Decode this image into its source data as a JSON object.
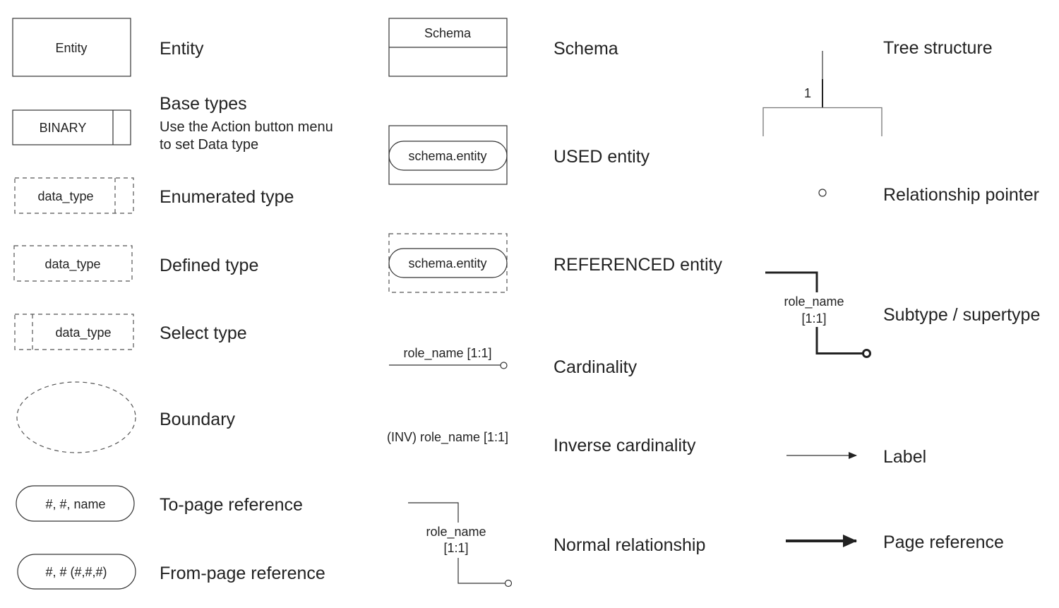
{
  "column1": {
    "entity": {
      "shape_text": "Entity",
      "label": "Entity"
    },
    "base_types": {
      "shape_text": "BINARY",
      "label": "Base types",
      "note_line1": "Use the Action button menu",
      "note_line2": "to set Data type"
    },
    "enumerated_type": {
      "shape_text": "data_type",
      "label": "Enumerated type"
    },
    "defined_type": {
      "shape_text": "data_type",
      "label": "Defined type"
    },
    "select_type": {
      "shape_text": "data_type",
      "label": "Select type"
    },
    "boundary": {
      "label": "Boundary"
    },
    "to_page_reference": {
      "shape_text": "#, #, name",
      "label": "To-page reference"
    },
    "from_page_reference": {
      "shape_text": "#, # (#,#,#)",
      "label": "From-page reference"
    }
  },
  "column2": {
    "schema": {
      "shape_text": "Schema",
      "label": "Schema"
    },
    "used_entity": {
      "shape_text": "schema.entity",
      "label": "USED entity"
    },
    "referenced_entity": {
      "shape_text": "schema.entity",
      "label": "REFERENCED entity"
    },
    "cardinality": {
      "shape_text": "role_name [1:1]",
      "label": "Cardinality"
    },
    "inverse_cardinality": {
      "shape_text": "(INV) role_name [1:1]",
      "label": "Inverse cardinality"
    },
    "normal_relationship": {
      "role": "role_name",
      "card": "[1:1]",
      "label": "Normal relationship"
    }
  },
  "column3": {
    "tree_structure": {
      "number": "1",
      "label": "Tree structure"
    },
    "relationship_pointer": {
      "label": "Relationship pointer"
    },
    "subtype_supertype": {
      "role": "role_name",
      "card": "[1:1]",
      "label": "Subtype / supertype"
    },
    "label_arrow": {
      "label": "Label"
    },
    "page_reference": {
      "label": "Page reference"
    }
  }
}
